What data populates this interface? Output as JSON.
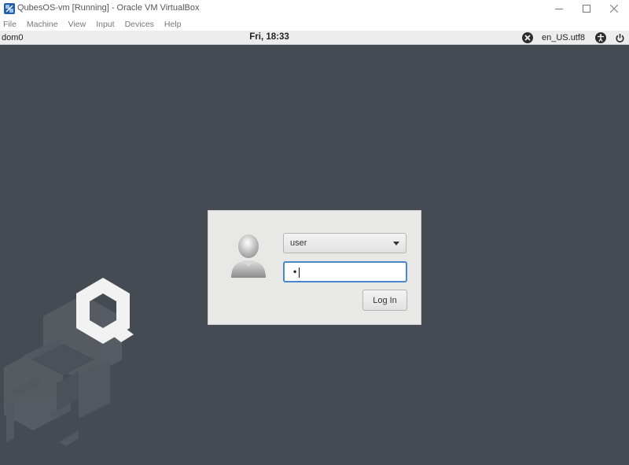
{
  "window": {
    "title": "QubesOS-vm [Running] - Oracle VM VirtualBox",
    "controls": [
      "minimize-icon",
      "maximize-icon",
      "close-icon"
    ]
  },
  "menubar": {
    "items": [
      {
        "label": "File"
      },
      {
        "label": "Machine"
      },
      {
        "label": "View"
      },
      {
        "label": "Input"
      },
      {
        "label": "Devices"
      },
      {
        "label": "Help"
      }
    ]
  },
  "topbar": {
    "vm_name": "dom0",
    "clock": "Fri, 18:33",
    "locale": "en_US.utf8",
    "icons": [
      "keyboard-layout-icon",
      "accessibility-icon",
      "power-icon"
    ]
  },
  "login": {
    "selected_user": "user",
    "password_value": "•",
    "login_button": "Log In",
    "avatar_icon": "user-avatar-icon"
  },
  "colors": {
    "desktop_bg": "#454b53",
    "dialog_bg": "#e8e8e7",
    "focus_accent": "#4b88c9",
    "topbar_bg": "#ededed"
  }
}
